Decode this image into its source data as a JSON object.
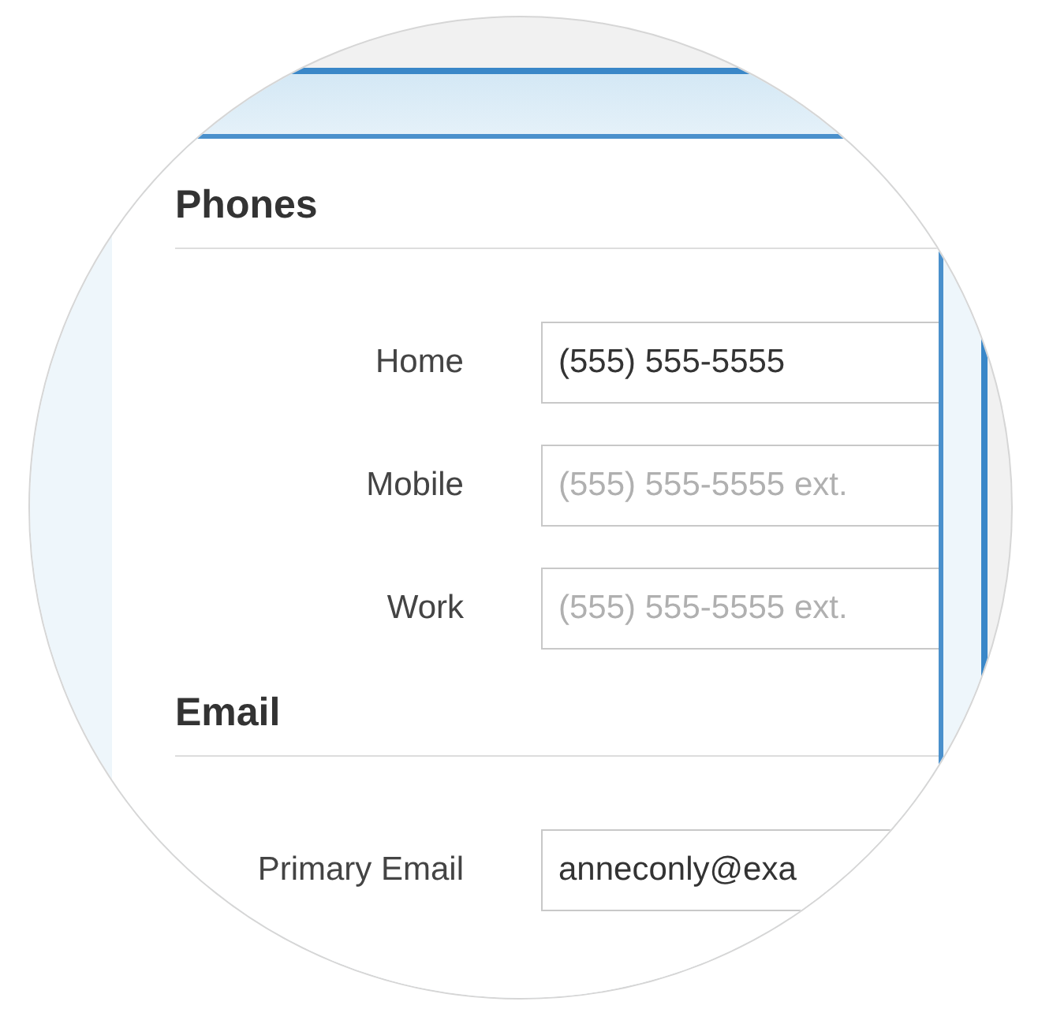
{
  "sections": [
    {
      "title": "Phones",
      "fields": [
        {
          "label": "Home",
          "value": "(555) 555-5555"
        },
        {
          "label": "Mobile",
          "placeholder": "(555) 555-5555 ext."
        },
        {
          "label": "Work",
          "placeholder": "(555) 555-5555 ext."
        }
      ]
    },
    {
      "title": "Email",
      "fields": [
        {
          "label": "Primary Email",
          "value": "anneconly@exa"
        }
      ]
    }
  ]
}
